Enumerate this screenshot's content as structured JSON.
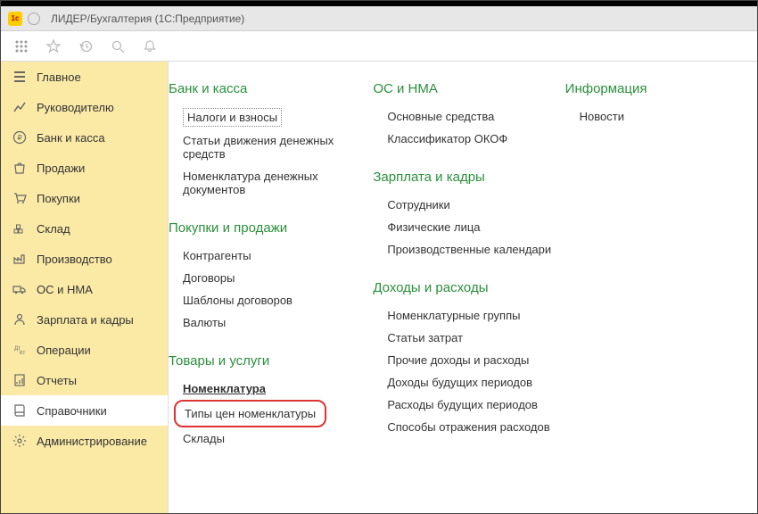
{
  "title": "ЛИДЕР/Бухгалтерия  (1С:Предприятие)",
  "sidebar": {
    "items": [
      {
        "label": "Главное",
        "icon": "menu"
      },
      {
        "label": "Руководителю",
        "icon": "chart"
      },
      {
        "label": "Банк и касса",
        "icon": "ruble"
      },
      {
        "label": "Продажи",
        "icon": "bag"
      },
      {
        "label": "Покупки",
        "icon": "cart"
      },
      {
        "label": "Склад",
        "icon": "stock"
      },
      {
        "label": "Производство",
        "icon": "factory"
      },
      {
        "label": "ОС и НМА",
        "icon": "truck"
      },
      {
        "label": "Зарплата и кадры",
        "icon": "person"
      },
      {
        "label": "Операции",
        "icon": "dkkt"
      },
      {
        "label": "Отчеты",
        "icon": "report"
      },
      {
        "label": "Справочники",
        "icon": "book",
        "active": true
      },
      {
        "label": "Администрирование",
        "icon": "gear"
      }
    ]
  },
  "columns": [
    {
      "sections": [
        {
          "title": "Банк и касса",
          "items": [
            {
              "label": "Налоги и взносы",
              "style": "dotted"
            },
            {
              "label": "Статьи движения денежных средств"
            },
            {
              "label": "Номенклатура денежных документов"
            }
          ]
        },
        {
          "title": "Покупки и продажи",
          "items": [
            {
              "label": "Контрагенты"
            },
            {
              "label": "Договоры"
            },
            {
              "label": "Шаблоны договоров"
            },
            {
              "label": "Валюты"
            }
          ]
        },
        {
          "title": "Товары и услуги",
          "items": [
            {
              "label": "Номенклатура",
              "style": "bold"
            },
            {
              "label": "Типы цен номенклатуры",
              "style": "redbox"
            },
            {
              "label": "Склады"
            }
          ]
        }
      ]
    },
    {
      "sections": [
        {
          "title": "ОС и НМА",
          "items": [
            {
              "label": "Основные средства"
            },
            {
              "label": "Классификатор ОКОФ"
            }
          ]
        },
        {
          "title": "Зарплата и кадры",
          "items": [
            {
              "label": "Сотрудники"
            },
            {
              "label": "Физические лица"
            },
            {
              "label": "Производственные календари"
            }
          ]
        },
        {
          "title": "Доходы и расходы",
          "items": [
            {
              "label": "Номенклатурные группы"
            },
            {
              "label": "Статьи затрат"
            },
            {
              "label": "Прочие доходы и расходы"
            },
            {
              "label": "Доходы будущих периодов"
            },
            {
              "label": "Расходы будущих периодов"
            },
            {
              "label": "Способы отражения расходов"
            }
          ]
        }
      ]
    },
    {
      "sections": [
        {
          "title": "Информация",
          "items": [
            {
              "label": "Новости"
            }
          ]
        }
      ]
    }
  ]
}
